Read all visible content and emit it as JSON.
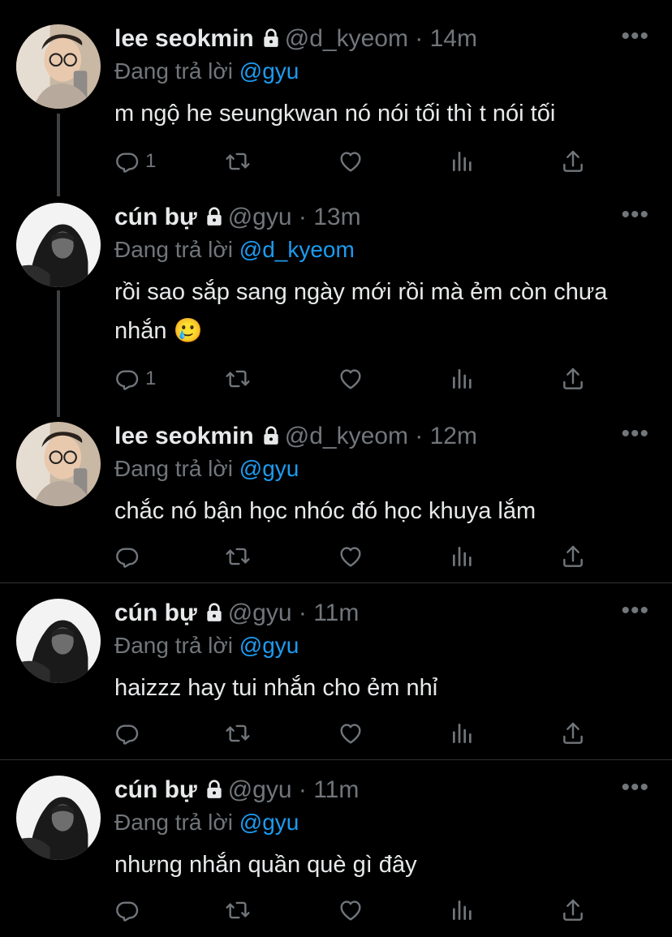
{
  "tweets": [
    {
      "name": "lee seokmin",
      "handle": "@d_kyeom",
      "time": "· 14m",
      "reply_prefix": "Đang trả lời",
      "reply_to": "@gyu",
      "text": "m ngộ he seungkwan nó nói tối thì t nói tối",
      "reply_count": "1",
      "avatar": "seokmin"
    },
    {
      "name": "cún bự",
      "handle": "@gyu",
      "time": "· 13m",
      "reply_prefix": "Đang trả lời",
      "reply_to": "@d_kyeom",
      "text": "rồi sao sắp sang ngày mới rồi mà ẻm còn chưa nhắn 🥲",
      "reply_count": "1",
      "avatar": "gyu"
    },
    {
      "name": "lee seokmin",
      "handle": "@d_kyeom",
      "time": "· 12m",
      "reply_prefix": "Đang trả lời",
      "reply_to": "@gyu",
      "text": "chắc nó bận học nhóc đó học khuya lắm",
      "reply_count": "",
      "avatar": "seokmin"
    },
    {
      "name": "cún bự",
      "handle": "@gyu",
      "time": "· 11m",
      "reply_prefix": "Đang trả lời",
      "reply_to": "@gyu",
      "text": "haizzz hay tui nhắn cho ẻm nhỉ",
      "reply_count": "",
      "avatar": "gyu"
    },
    {
      "name": "cún bự",
      "handle": "@gyu",
      "time": "· 11m",
      "reply_prefix": "Đang trả lời",
      "reply_to": "@gyu",
      "text": "nhưng nhắn quần què gì đây",
      "reply_count": "",
      "avatar": "gyu"
    }
  ],
  "icons": {
    "more": "more-icon",
    "lock": "lock-icon",
    "reply": "reply-icon",
    "retweet": "retweet-icon",
    "like": "like-icon",
    "views": "views-icon",
    "share": "share-icon"
  },
  "colors": {
    "background": "#000000",
    "text": "#e7e9ea",
    "muted": "#71767b",
    "link": "#1d9bf0",
    "divider": "#2f3336"
  }
}
